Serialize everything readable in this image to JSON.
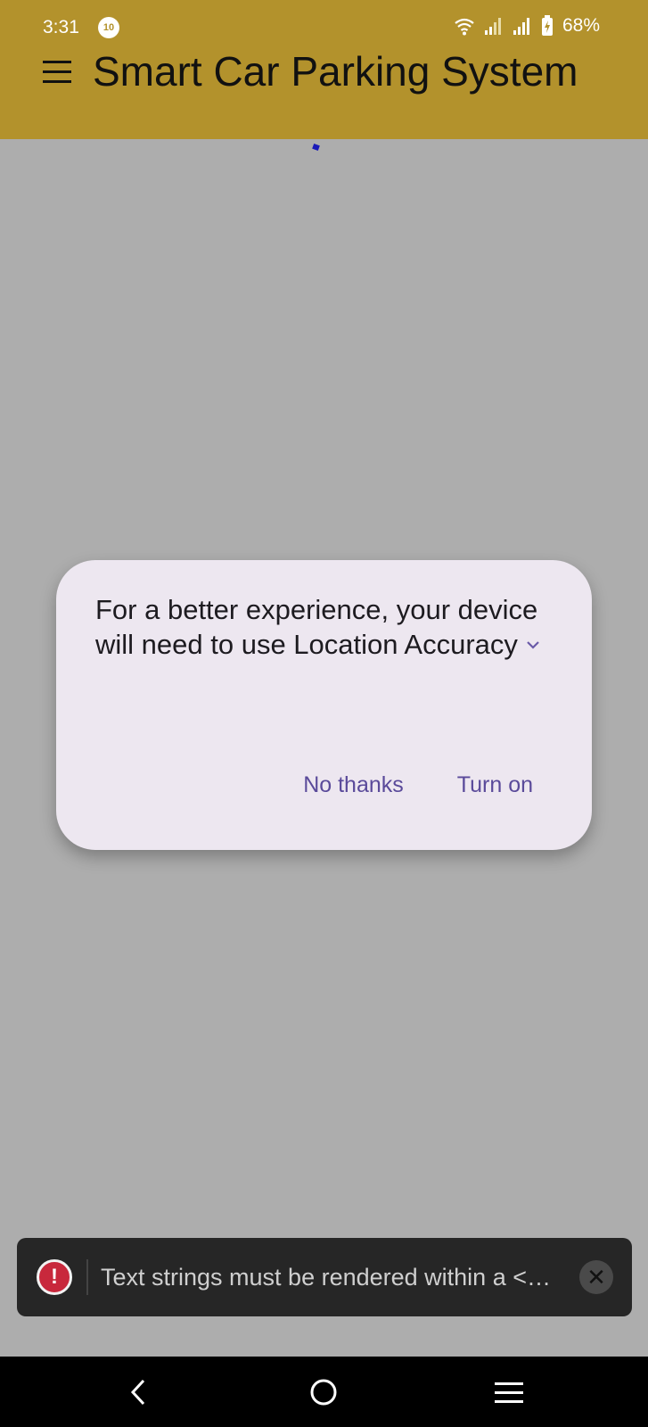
{
  "status_bar": {
    "time": "3:31",
    "notification_badge": "10",
    "battery": "68%"
  },
  "app_bar": {
    "title": "Smart Car Parking System",
    "background_color": "#b3922c"
  },
  "dialog": {
    "message": "For a better experience, your device will need to use Location Accuracy",
    "no_thanks_label": "No thanks",
    "turn_on_label": "Turn on"
  },
  "toast": {
    "message": "Text strings must be rendered within a <…",
    "icon": "error-icon",
    "close_symbol": "✕"
  },
  "nav_bar": {
    "icons": [
      "back-icon",
      "home-icon",
      "recent-apps-icon"
    ]
  }
}
